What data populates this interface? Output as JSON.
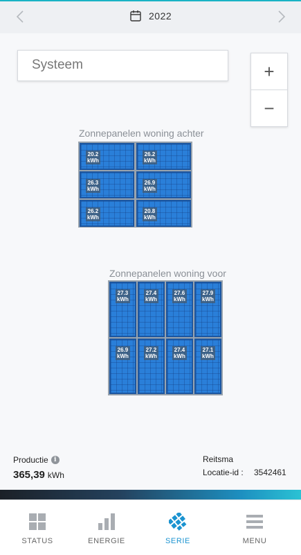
{
  "header": {
    "year": "2022",
    "prev_icon": "chevron-left-icon",
    "next_icon": "chevron-right-icon",
    "calendar_icon": "calendar-icon"
  },
  "system_selector": {
    "value": "Systeem"
  },
  "zoom": {
    "in_label": "+",
    "out_label": "−"
  },
  "groups": [
    {
      "title": "Zonnepanelen woning achter",
      "panels": [
        {
          "value": "20.2",
          "unit": "kWh"
        },
        {
          "value": "26.2",
          "unit": "kWh"
        },
        {
          "value": "26.3",
          "unit": "kWh"
        },
        {
          "value": "26.9",
          "unit": "kWh"
        },
        {
          "value": "26.2",
          "unit": "kWh"
        },
        {
          "value": "20.8",
          "unit": "kWh"
        }
      ]
    },
    {
      "title": "Zonnepanelen woning voor",
      "panels": [
        {
          "value": "27.3",
          "unit": "kWh"
        },
        {
          "value": "27.4",
          "unit": "kWh"
        },
        {
          "value": "27.6",
          "unit": "kWh"
        },
        {
          "value": "27.9",
          "unit": "kWh"
        },
        {
          "value": "26.9",
          "unit": "kWh"
        },
        {
          "value": "27.2",
          "unit": "kWh"
        },
        {
          "value": "27.4",
          "unit": "kWh"
        },
        {
          "value": "27.1",
          "unit": "kWh"
        }
      ]
    }
  ],
  "info": {
    "production_label": "Productie",
    "production_value": "365,39",
    "production_unit": "kWh",
    "owner": "Reitsma",
    "location_label": "Locatie-id :",
    "location_id": "3542461"
  },
  "tabs": [
    {
      "label": "STATUS",
      "icon": "grid-icon",
      "active": false
    },
    {
      "label": "ENERGIE",
      "icon": "bar-chart-icon",
      "active": false
    },
    {
      "label": "SERIE",
      "icon": "solar-panel-icon",
      "active": true
    },
    {
      "label": "MENU",
      "icon": "hamburger-icon",
      "active": false
    }
  ],
  "colors": {
    "accent": "#1b93d0",
    "panel_blue": "#2a7fd9",
    "top_accent": "#19b3c4"
  }
}
